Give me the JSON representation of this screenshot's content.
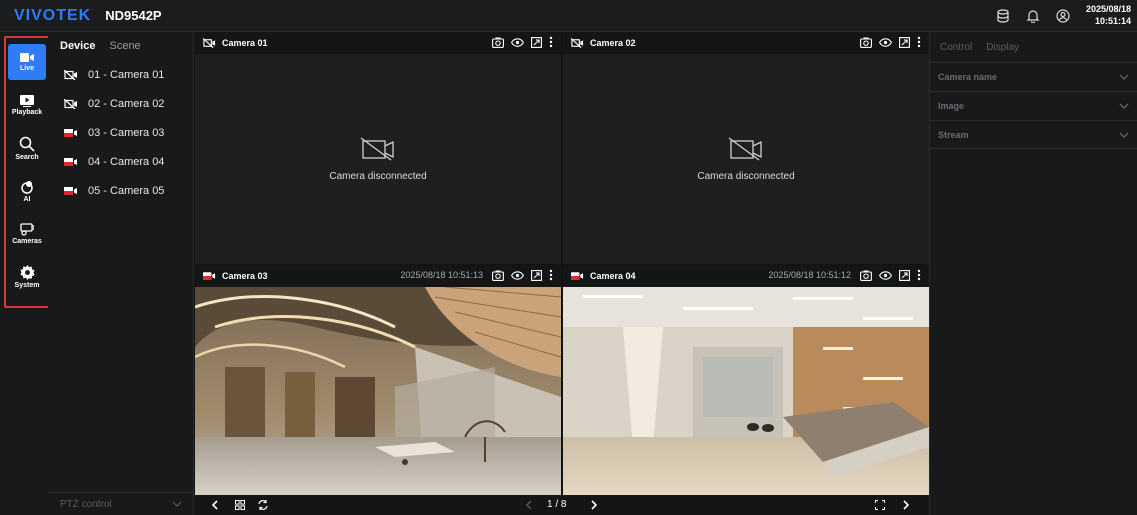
{
  "header": {
    "logo": "VIVOTEK",
    "model": "ND9542P",
    "date": "2025/08/18",
    "time": "10:51:14"
  },
  "nav": [
    {
      "label": "Live",
      "icon": "live-icon",
      "active": true
    },
    {
      "label": "Playback",
      "icon": "playback-icon"
    },
    {
      "label": "Search",
      "icon": "search-icon"
    },
    {
      "label": "AI",
      "icon": "ai-icon"
    },
    {
      "label": "Cameras",
      "icon": "cameras-icon"
    },
    {
      "label": "System",
      "icon": "gear-icon"
    }
  ],
  "device_panel": {
    "tabs": [
      "Device",
      "Scene"
    ],
    "devices": [
      {
        "label": "01 - Camera 01",
        "status": "disconnected"
      },
      {
        "label": "02 - Camera 02",
        "status": "disconnected"
      },
      {
        "label": "03 - Camera 03",
        "status": "recording"
      },
      {
        "label": "04 - Camera 04",
        "status": "recording"
      },
      {
        "label": "05 - Camera 05",
        "status": "recording"
      }
    ],
    "ptz_label": "PTZ control"
  },
  "tiles": [
    {
      "title": "Camera 01",
      "timestamp": "",
      "message": "Camera disconnected",
      "status": "disconnected"
    },
    {
      "title": "Camera 02",
      "timestamp": "",
      "message": "Camera disconnected",
      "status": "disconnected"
    },
    {
      "title": "Camera 03",
      "timestamp": "2025/08/18 10:51:13",
      "message": "",
      "status": "live"
    },
    {
      "title": "Camera 04",
      "timestamp": "2025/08/18 10:51:12",
      "message": "",
      "status": "live"
    }
  ],
  "bottom_bar": {
    "page": "1 / 8"
  },
  "right_panel": {
    "tabs": [
      "Control",
      "Display"
    ],
    "sections": [
      "Camera name",
      "Image",
      "Stream"
    ]
  },
  "colors": {
    "accent": "#2f7df6",
    "highlight_outline": "#d9373a",
    "recording": "#e8242b"
  }
}
